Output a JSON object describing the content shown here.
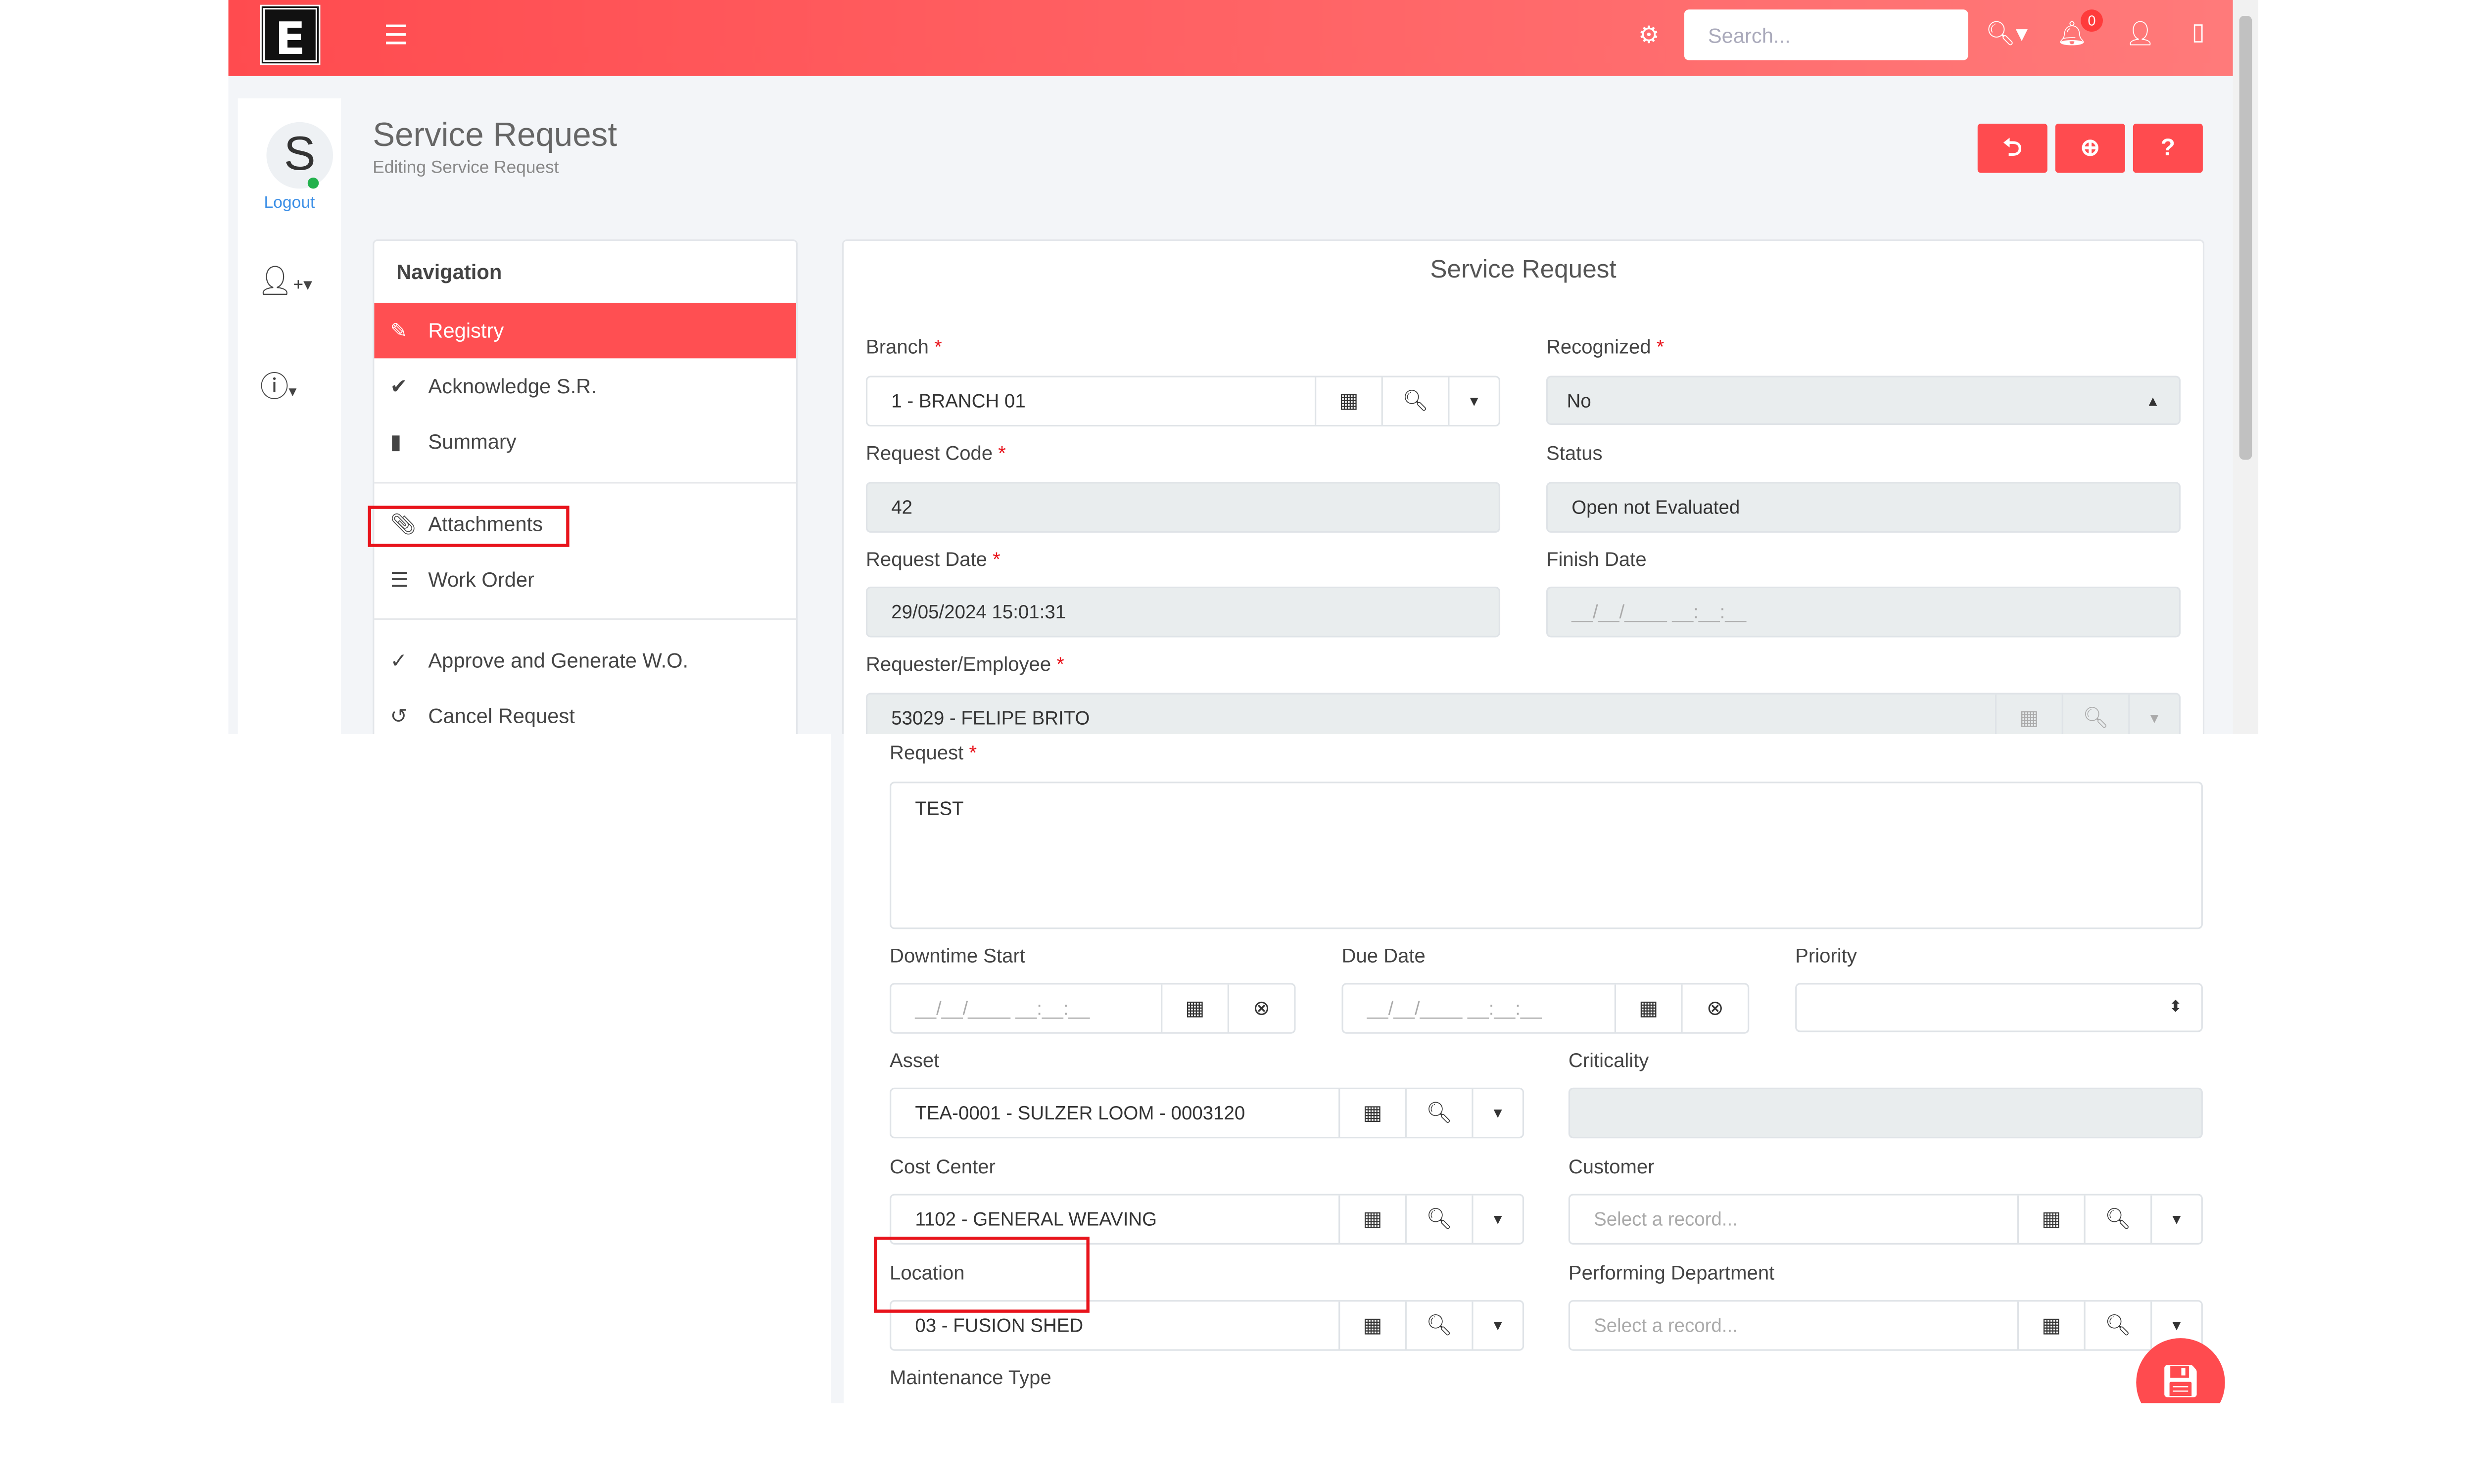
{
  "header": {
    "search_placeholder": "Search...",
    "notification_count": "0",
    "accent": "#ff4b4f"
  },
  "user": {
    "initial": "S",
    "logout": "Logout"
  },
  "page": {
    "title": "Service Request",
    "subtitle": "Editing Service Request"
  },
  "navigation": {
    "title": "Navigation",
    "items": [
      {
        "label": "Registry",
        "icon": "edit-icon",
        "active": true
      },
      {
        "label": "Acknowledge S.R.",
        "icon": "check-circle-icon"
      },
      {
        "label": "Summary",
        "icon": "file-icon"
      },
      {
        "label": "Attachments",
        "icon": "paperclip-icon",
        "highlighted": true
      },
      {
        "label": "Work Order",
        "icon": "list-icon"
      },
      {
        "label": "Approve and Generate W.O.",
        "icon": "check-icon"
      },
      {
        "label": "Cancel Request",
        "icon": "undo-icon"
      }
    ]
  },
  "form": {
    "title": "Service Request",
    "branch": {
      "label": "Branch",
      "value": "1 - BRANCH 01"
    },
    "recognized": {
      "label": "Recognized",
      "value": "No"
    },
    "request_code": {
      "label": "Request Code",
      "value": "42"
    },
    "status": {
      "label": "Status",
      "value": "Open not Evaluated"
    },
    "request_date": {
      "label": "Request Date",
      "value": "29/05/2024 15:01:31"
    },
    "finish_date": {
      "label": "Finish Date",
      "placeholder": "__/__/____ __:__:__"
    },
    "requester": {
      "label": "Requester/Employee",
      "value": "53029 - FELIPE BRITO"
    },
    "request": {
      "label": "Request",
      "value": "TEST"
    },
    "downtime_start": {
      "label": "Downtime Start",
      "placeholder": "__/__/____ __:__:__"
    },
    "due_date": {
      "label": "Due Date",
      "placeholder": "__/__/____ __:__:__"
    },
    "priority": {
      "label": "Priority",
      "value": ""
    },
    "asset": {
      "label": "Asset",
      "value": "TEA-0001 - SULZER LOOM - 0003120"
    },
    "criticality": {
      "label": "Criticality",
      "value": ""
    },
    "cost_center": {
      "label": "Cost Center",
      "value": "1102 - GENERAL WEAVING"
    },
    "customer": {
      "label": "Customer",
      "placeholder": "Select a record..."
    },
    "location": {
      "label": "Location",
      "value": "03 - FUSION SHED"
    },
    "performing_department": {
      "label": "Performing Department",
      "placeholder": "Select a record..."
    },
    "maintenance_type": {
      "label": "Maintenance Type"
    },
    "required_mark": "*"
  }
}
